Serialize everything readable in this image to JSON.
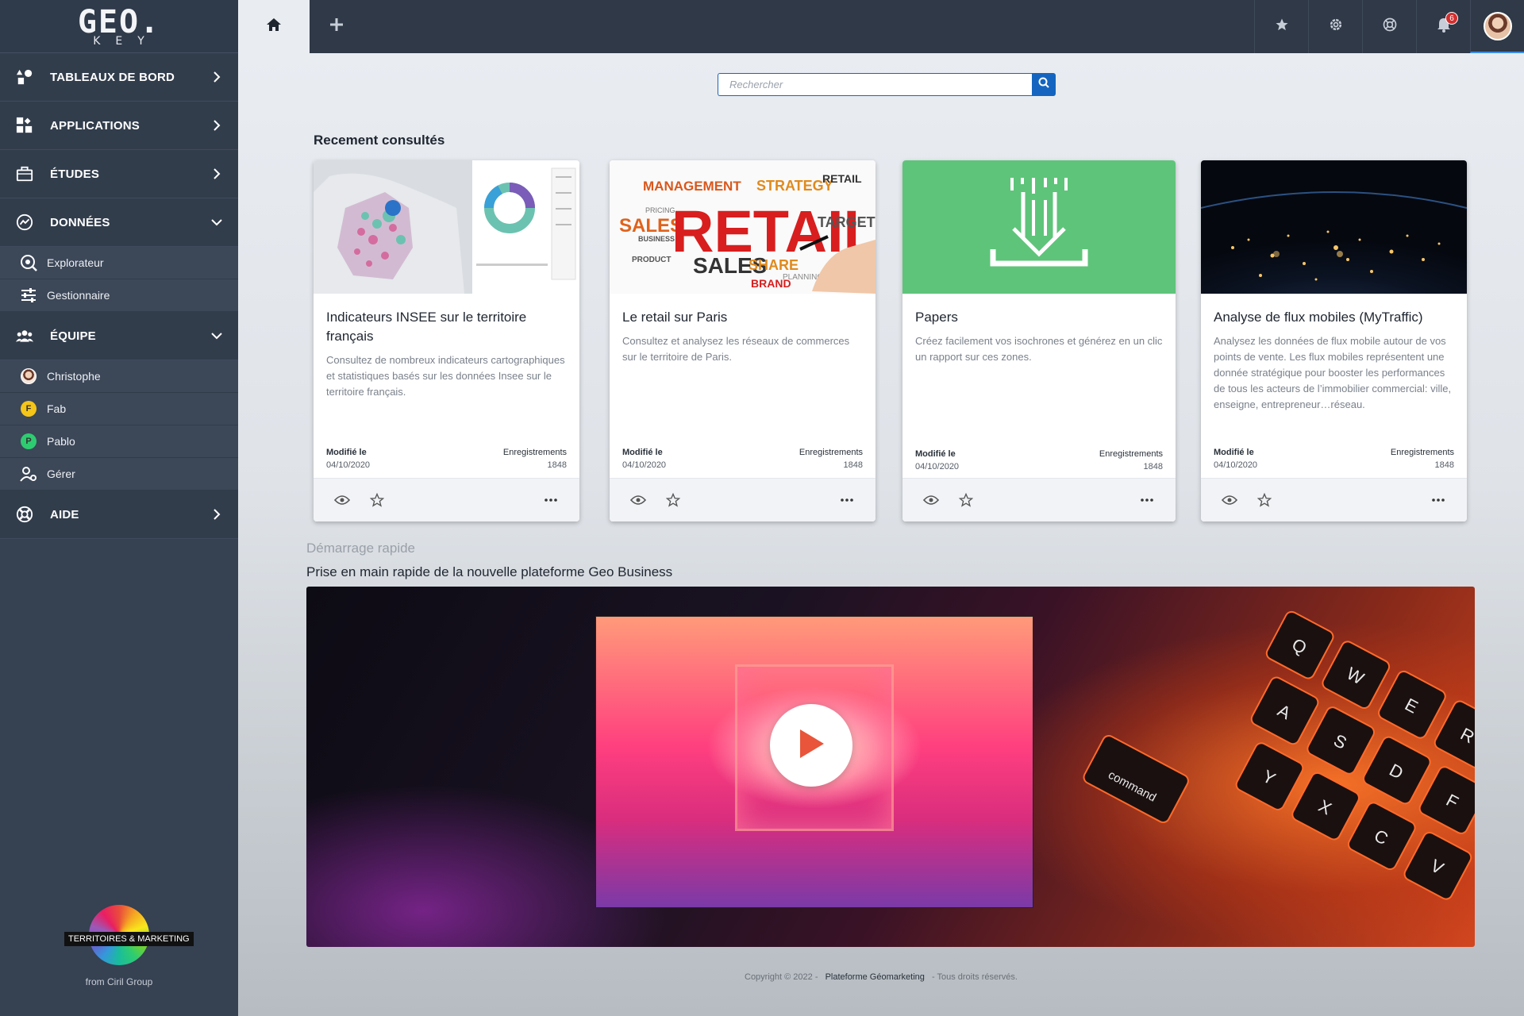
{
  "logo": {
    "main": "GEO.",
    "sub": "KEY"
  },
  "sidebar": {
    "items": [
      {
        "label": "TABLEAUX DE BORD",
        "icon": "shapes-icon",
        "expanded": false
      },
      {
        "label": "APPLICATIONS",
        "icon": "apps-icon",
        "expanded": false
      },
      {
        "label": "ÉTUDES",
        "icon": "briefcase-icon",
        "expanded": false
      },
      {
        "label": "DONNÉES",
        "icon": "chart-icon",
        "expanded": true,
        "children": [
          {
            "label": "Explorateur",
            "icon": "explore-icon"
          },
          {
            "label": "Gestionnaire",
            "icon": "sliders-icon"
          }
        ]
      },
      {
        "label": "ÉQUIPE",
        "icon": "team-icon",
        "expanded": true,
        "children": [
          {
            "label": "Christophe",
            "icon": "avatar-photo"
          },
          {
            "label": "Fab",
            "icon": "avatar-letter",
            "letter": "F",
            "color": "#f5c518"
          },
          {
            "label": "Pablo",
            "icon": "avatar-letter",
            "letter": "P",
            "color": "#2ecc71"
          },
          {
            "label": "Gérer",
            "icon": "manage-icon"
          }
        ]
      },
      {
        "label": "AIDE",
        "icon": "help-icon",
        "expanded": false
      }
    ],
    "brand": {
      "label": "TERRITOIRES & MARKETING",
      "from": "from Ciril Group"
    }
  },
  "topbar": {
    "tabs": [
      {
        "icon": "home-icon",
        "active": true
      },
      {
        "icon": "plus-icon"
      }
    ],
    "icons": [
      "star-icon",
      "gear-icon",
      "support-icon",
      "bell-icon",
      "user-avatar"
    ],
    "notifications": "6"
  },
  "search": {
    "placeholder": "Rechercher"
  },
  "recent": {
    "title": "Recement consultés",
    "cards": [
      {
        "title": "Indicateurs INSEE sur le territoire français",
        "desc": "Consultez de nombreux indicateurs cartographiques et statistiques basés sur les données Insee sur le territoire français.",
        "modified_label": "Modifié le",
        "modified": "04/10/2020",
        "records_label": "Enregistrements",
        "records": "1848"
      },
      {
        "title": "Le retail sur Paris",
        "desc": "Consultez et analysez les réseaux de commerces sur le territoire de Paris.",
        "modified_label": "Modifié le",
        "modified": "04/10/2020",
        "records_label": "Enregistrements",
        "records": "1848"
      },
      {
        "title": "Papers",
        "desc": "Créez facilement vos isochrones et générez en un clic un rapport sur ces zones.",
        "modified_label": "Modifié le",
        "modified": "04/10/2020",
        "records_label": "Enregistrements",
        "records": "1848"
      },
      {
        "title": "Analyse de flux mobiles (MyTraffic)",
        "desc": "Analysez les données de flux mobile autour de vos points de vente. Les flux mobiles représentent une donnée stratégique pour booster les performances de tous les acteurs de l’immobilier commercial: ville, enseigne, entrepreneur…réseau.",
        "modified_label": "Modifié le",
        "modified": "04/10/2020",
        "records_label": "Enregistrements",
        "records": "1848"
      }
    ]
  },
  "quickstart": {
    "title": "Démarrage rapide",
    "subtitle": "Prise en main rapide de la nouvelle plateforme Geo Business"
  },
  "retail_words": {
    "big": "RETAIL",
    "words": [
      "MANAGEMENT",
      "STRATEGY",
      "RETAIL",
      "SALES",
      "TARGET",
      "SALES",
      "SHARE",
      "BRAND",
      "PRODUCT",
      "BUSINESS",
      "PLANNING",
      "PRICING"
    ]
  },
  "keyboard_keys": [
    "Q",
    "W",
    "E",
    "R",
    "A",
    "S",
    "D",
    "F",
    "Y",
    "X",
    "C",
    "V",
    "command"
  ],
  "footer": {
    "copyright": "Copyright © 2022 -",
    "link": "Plateforme Géomarketing",
    "rights": "- Tous droits réservés."
  },
  "colors": {
    "sidebar": "#364152",
    "topbar": "#2f3947",
    "accent": "#1565c0",
    "papers": "#5ec47a"
  }
}
